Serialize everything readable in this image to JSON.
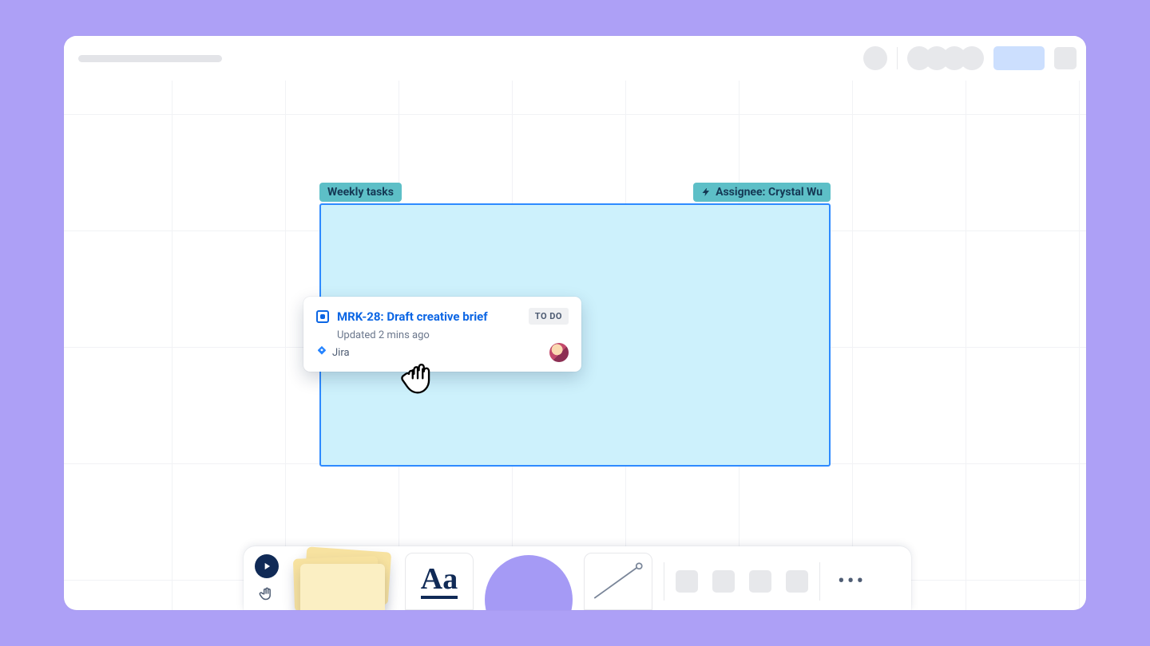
{
  "section": {
    "title": "Weekly tasks",
    "assignee_label": "Assignee: Crystal Wu"
  },
  "card": {
    "key_and_title": "MRK-28: Draft creative brief",
    "updated": "Updated 2 mins ago",
    "status": "TO DO",
    "source": "Jira"
  },
  "toolbar": {
    "text_label": "Aa",
    "more_label": "•••"
  }
}
